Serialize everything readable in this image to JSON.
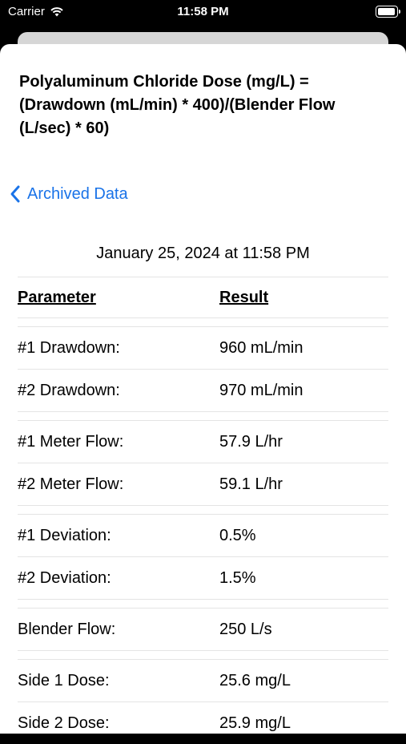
{
  "status": {
    "carrier": "Carrier",
    "time": "11:58 PM",
    "wifi_icon": "wifi-icon",
    "battery_level": 1.0
  },
  "formula": "Polyaluminum Chloride Dose (mg/L) = (Drawdown (mL/min) * 400)/(Blender Flow (L/sec) * 60)",
  "nav": {
    "back_label": "Archived Data",
    "back_icon": "chevron-left-icon",
    "accent": "#1a73e8"
  },
  "timestamp": "January 25, 2024 at 11:58 PM",
  "table": {
    "headers": [
      "Parameter",
      "Result"
    ],
    "groups": [
      [
        {
          "param": "#1 Drawdown:",
          "result": "960 mL/min"
        },
        {
          "param": "#2 Drawdown:",
          "result": "970 mL/min"
        }
      ],
      [
        {
          "param": "#1 Meter Flow:",
          "result": "57.9 L/hr"
        },
        {
          "param": "#2 Meter Flow:",
          "result": "59.1 L/hr"
        }
      ],
      [
        {
          "param": "#1 Deviation:",
          "result": "0.5%"
        },
        {
          "param": "#2 Deviation:",
          "result": "1.5%"
        }
      ],
      [
        {
          "param": "Blender Flow:",
          "result": "250 L/s"
        }
      ],
      [
        {
          "param": "Side 1 Dose:",
          "result": "25.6 mg/L"
        },
        {
          "param": "Side 2 Dose:",
          "result": "25.9 mg/L"
        }
      ]
    ]
  }
}
